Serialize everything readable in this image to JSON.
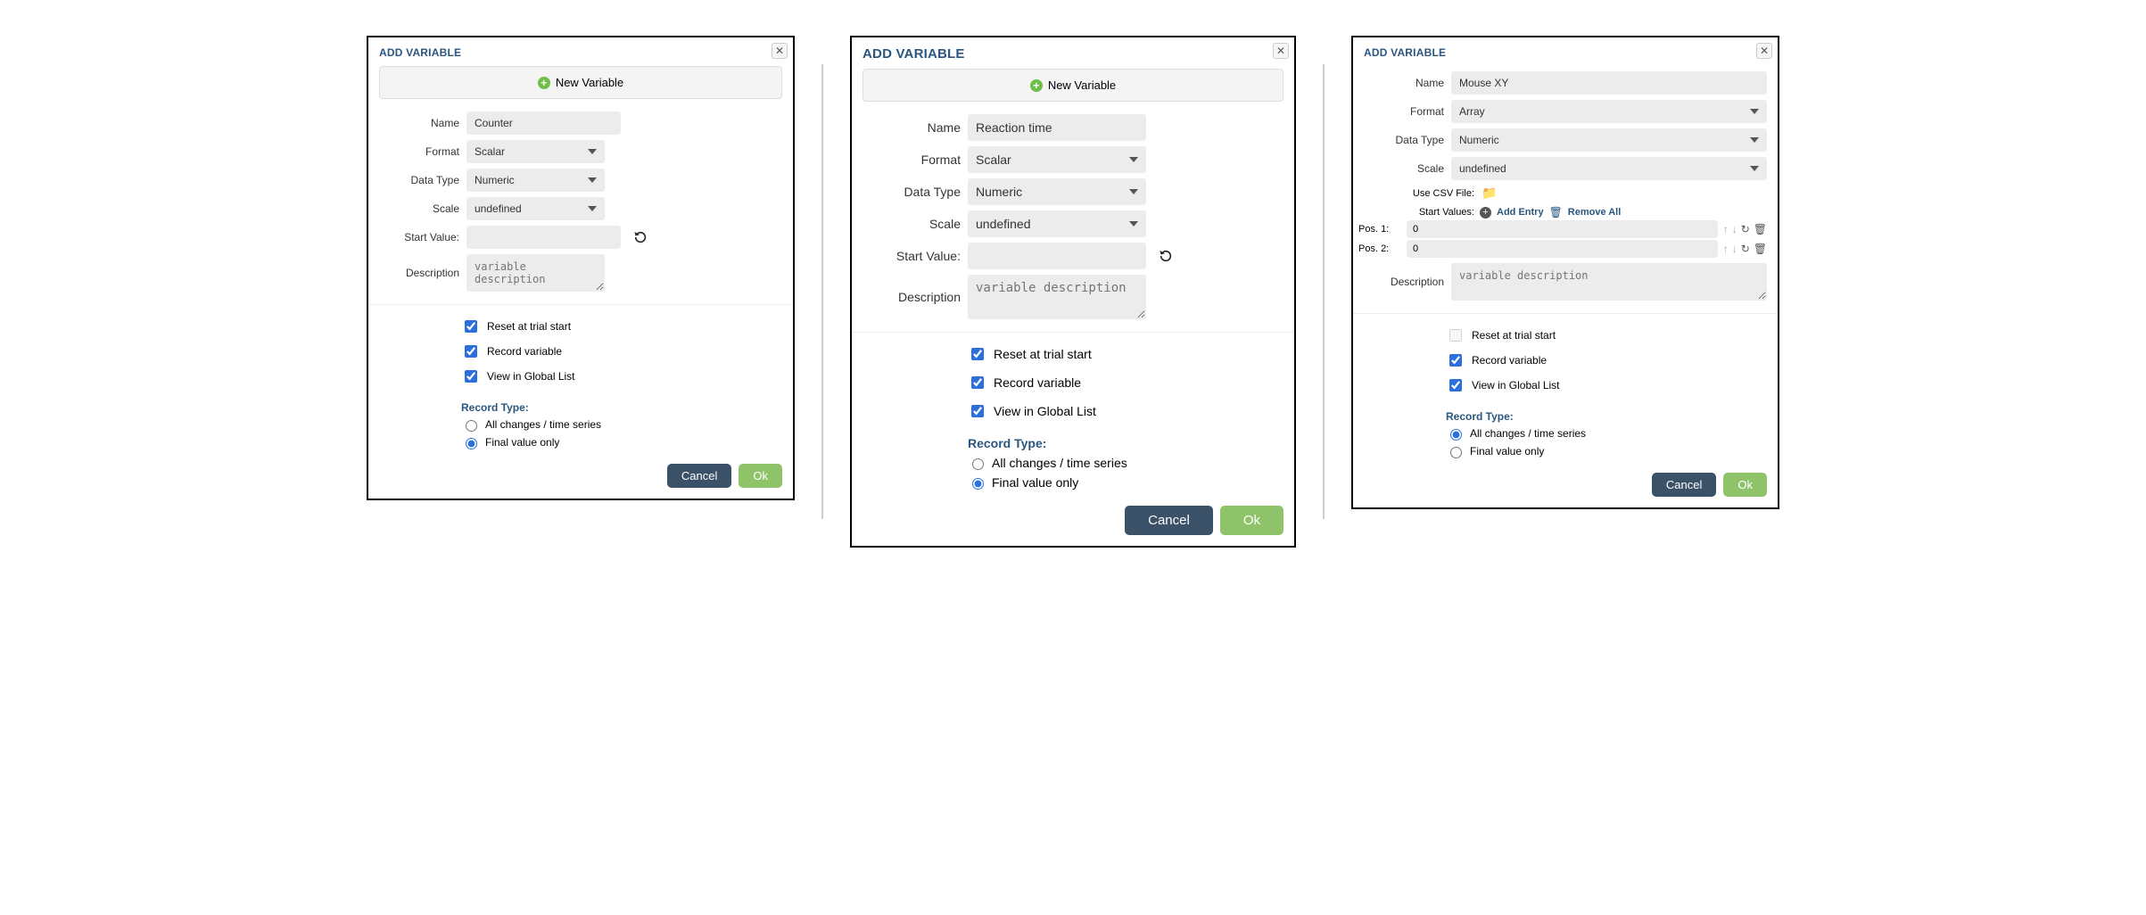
{
  "common": {
    "title": "ADD VARIABLE",
    "banner": "New Variable",
    "labels": {
      "name": "Name",
      "format": "Format",
      "dataType": "Data Type",
      "scale": "Scale",
      "startValue": "Start Value:",
      "startValues": "Start Values:",
      "description": "Description",
      "useCsv": "Use CSV File:"
    },
    "placeholders": {
      "description": "variable description"
    },
    "options": {
      "formatScalar": "Scalar",
      "formatArray": "Array",
      "dataTypeNumeric": "Numeric",
      "scaleUndefined": "undefined"
    },
    "checks": {
      "reset": "Reset at trial start",
      "record": "Record variable",
      "viewGlobal": "View in Global List"
    },
    "recordType": {
      "head": "Record Type:",
      "allChanges": "All changes / time series",
      "finalOnly": "Final value only"
    },
    "buttons": {
      "cancel": "Cancel",
      "ok": "Ok"
    },
    "arrayActions": {
      "addEntry": "Add Entry",
      "removeAll": "Remove All"
    }
  },
  "dlg1": {
    "name": "Counter",
    "format": "Scalar",
    "dataType": "Numeric",
    "scale": "undefined",
    "startValue": "",
    "resetChecked": true,
    "recordChecked": true,
    "viewChecked": true,
    "recordType": "finalOnly"
  },
  "dlg2": {
    "name": "Reaction time",
    "format": "Scalar",
    "dataType": "Numeric",
    "scale": "undefined",
    "startValue": "",
    "resetChecked": true,
    "recordChecked": true,
    "viewChecked": true,
    "recordType": "finalOnly"
  },
  "dlg3": {
    "name": "Mouse XY",
    "format": "Array",
    "dataType": "Numeric",
    "scale": "undefined",
    "positions": [
      {
        "label": "Pos. 1:",
        "value": "0"
      },
      {
        "label": "Pos. 2:",
        "value": "0"
      }
    ],
    "resetChecked": false,
    "resetDisabled": true,
    "recordChecked": true,
    "viewChecked": true,
    "recordType": "allChanges"
  }
}
